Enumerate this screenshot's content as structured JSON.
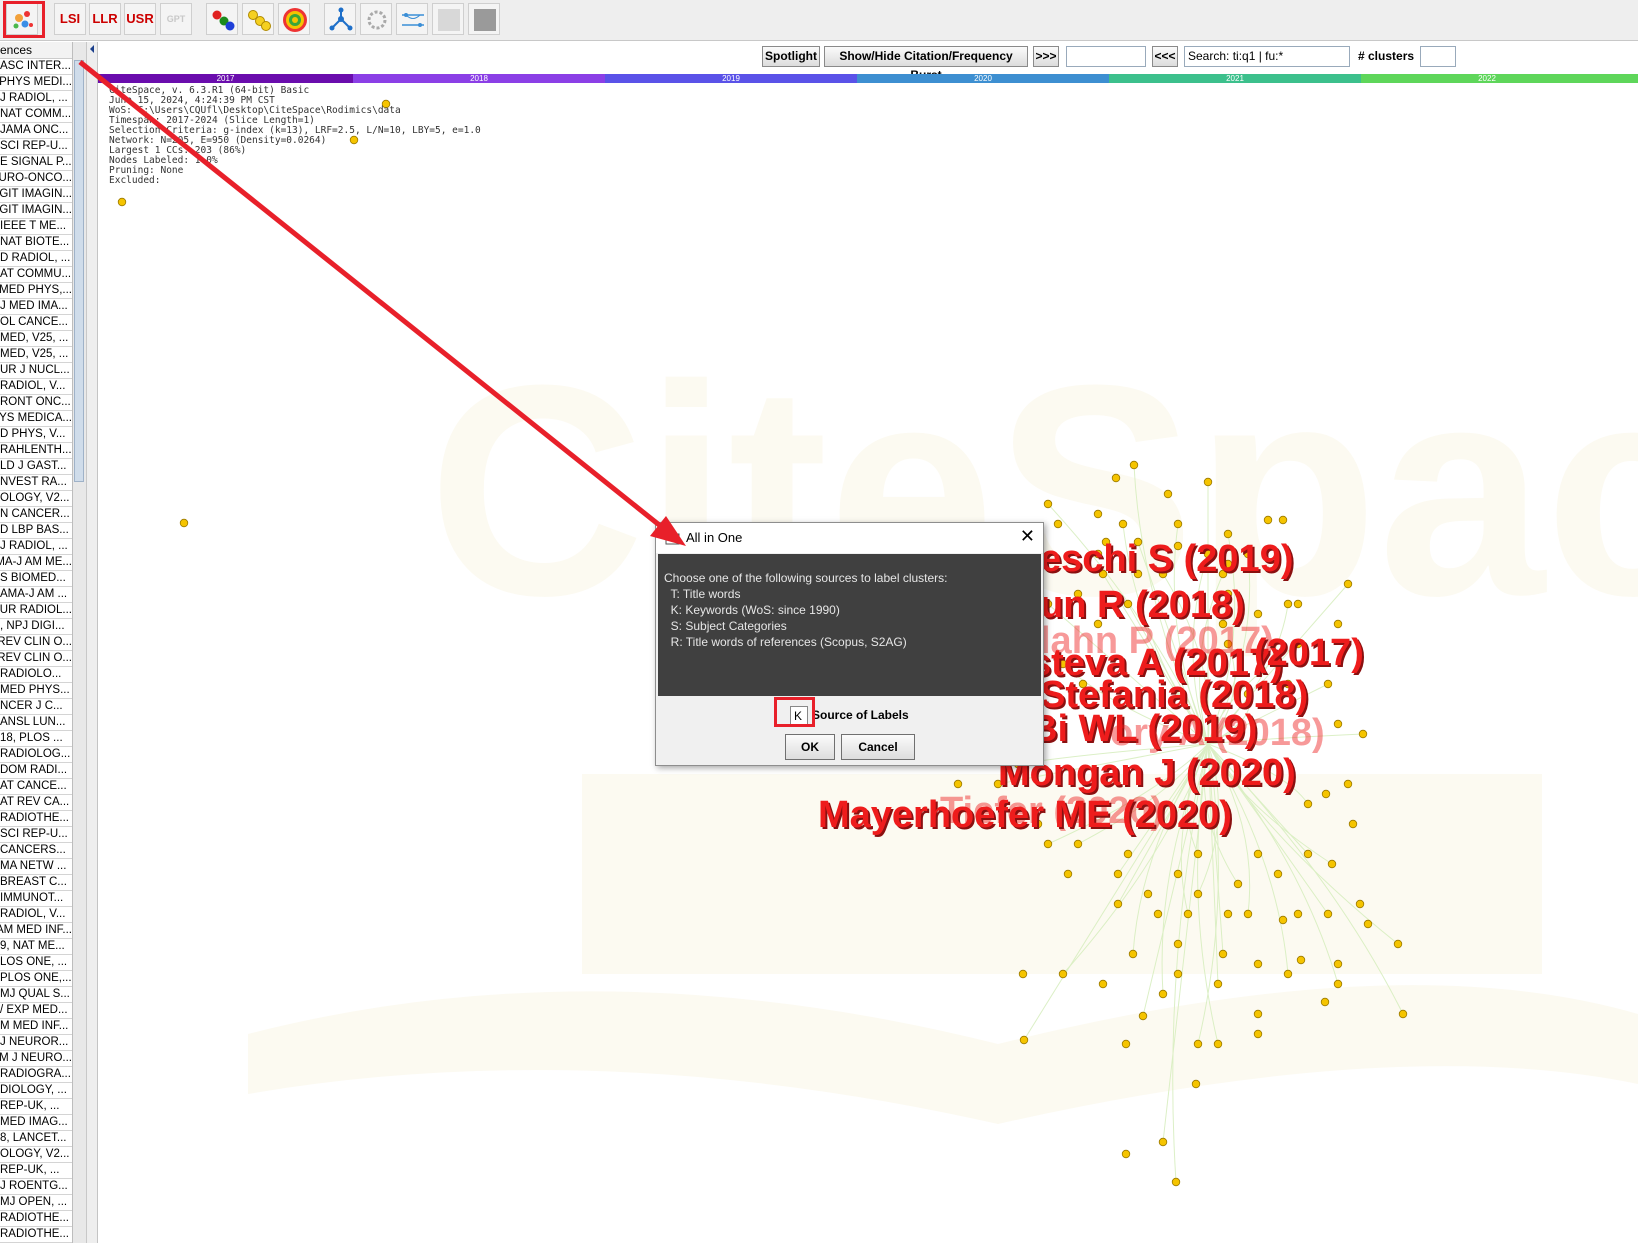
{
  "toolbar": {
    "buttons": [
      {
        "name": "cluster-explore-icon",
        "label": ""
      },
      {
        "name": "lsi-button",
        "label": "LSI"
      },
      {
        "name": "llr-button",
        "label": "LLR"
      },
      {
        "name": "usr-button",
        "label": "USR"
      },
      {
        "name": "gpt-button",
        "label": "GPT"
      },
      {
        "name": "nodes-color-icon",
        "label": ""
      },
      {
        "name": "nodes-yellow-icon",
        "label": ""
      },
      {
        "name": "target-icon",
        "label": ""
      },
      {
        "name": "network-icon",
        "label": ""
      },
      {
        "name": "circle-layout-icon",
        "label": ""
      },
      {
        "name": "timeline-icon",
        "label": ""
      },
      {
        "name": "image-icon",
        "label": ""
      },
      {
        "name": "photo-icon",
        "label": ""
      }
    ]
  },
  "left_list": {
    "header": "ences",
    "items": [
      "ASC INTER...",
      "PHYS MEDI...",
      "J RADIOL, ...",
      "NAT COMM...",
      "JAMA ONC...",
      "SCI REP-U...",
      "E SIGNAL P...",
      "URO-ONCO...",
      "GIT IMAGIN...",
      "GIT IMAGIN...",
      "IEEE T ME...",
      "NAT BIOTE...",
      "D RADIOL, ...",
      "AT COMMU...",
      "MED PHYS,...",
      "J MED IMA...",
      "OL CANCE...",
      "MED, V25, ...",
      "MED, V25, ...",
      "UR J NUCL...",
      "RADIOL, V...",
      "RONT ONC...",
      "YS MEDICA...",
      "D PHYS, V...",
      "RAHLENTH...",
      "LD J GAST...",
      "NVEST RA...",
      "OLOGY, V2...",
      "N CANCER...",
      "D LBP BAS...",
      "J RADIOL, ...",
      "MA-J AM ME...",
      "S BIOMED...",
      "AMA-J AM ...",
      "UR RADIOL...",
      ", NPJ DIGI...",
      "REV CLIN O...",
      "REV CLIN O...",
      "RADIOLO...",
      "MED PHYS...",
      "NCER J C...",
      "ANSL LUN...",
      "18, PLOS ...",
      "RADIOLOG...",
      "DOM RADI...",
      "AT CANCE...",
      "AT REV CA...",
      "RADIOTHE...",
      "SCI REP-U...",
      "CANCERS...",
      "MA NETW ...",
      "BREAST C...",
      "IMMUNOT...",
      "RADIOL, V...",
      "AM MED INF...",
      "9, NAT ME...",
      "LOS ONE, ...",
      "PLOS ONE,...",
      "MJ QUAL S...",
      "/ EXP MED...",
      "M MED INF...",
      "J NEUROR...",
      "M J NEURO...",
      "RADIOGRA...",
      "DIOLOGY, ...",
      "REP-UK, ...",
      "MED IMAG...",
      "8, LANCET...",
      "OLOGY, V2...",
      "REP-UK, ...",
      "J ROENTG...",
      "MJ OPEN, ...",
      "RADIOTHE...",
      "RADIOTHE..."
    ]
  },
  "controls": {
    "spotlight": "Spotlight",
    "burst": "Show/Hide Citation/Frequency Burst",
    "next": ">>>",
    "prev": "<<<",
    "search_value": "Search: ti:q1 | fu:*",
    "clusters_label": "# clusters",
    "blank_field": "",
    "clusters_value": ""
  },
  "timeline": {
    "years": [
      "2017",
      "2018",
      "2019",
      "2020",
      "2021",
      "2022"
    ],
    "colors": [
      "#6a0dad",
      "#8b3fe6",
      "#5a52e8",
      "#3d8fd1",
      "#3cc08c",
      "#5ed65a"
    ]
  },
  "info": {
    "lines": [
      "CiteSpace, v. 6.3.R1 (64-bit) Basic",
      "June 15, 2024, 4:24:39 PM CST",
      "WoS: C:\\Users\\CQUfl\\Desktop\\CiteSpace\\Rodimics\\data",
      "Timespan: 2017-2024 (Slice Length=1)",
      "Selection Criteria: g-index (k=13), LRF=2.5, L/N=10, LBY=5, e=1.0",
      "Network: N=205, E=950 (Density=0.0264)",
      "Largest 1 CCs: 203 (86%)",
      "Nodes Labeled: 1.0%",
      "Pruning: None",
      "Excluded:"
    ]
  },
  "node_labels": [
    {
      "text": "eschi S (2019)",
      "ghost": false
    },
    {
      "text": "un R (2018)",
      "ghost": false
    },
    {
      "text": "lahn P (2017)",
      "ghost": true
    },
    {
      "text": "steva A (2017)",
      "ghost": false
    },
    {
      "text": "(2017)",
      "ghost": false
    },
    {
      "text": "Stefania (2018)",
      "ghost": false
    },
    {
      "text": "Bi WL (2019)",
      "ghost": false
    },
    {
      "text": "ory A (2018)",
      "ghost": true
    },
    {
      "text": "Mongan J (2020)",
      "ghost": false
    },
    {
      "text": "Mayerhoefer ME (2020)",
      "ghost": false
    },
    {
      "text": "Tiefer (2020)",
      "ghost": true
    }
  ],
  "dialog": {
    "title": "All in One",
    "close": "✕",
    "prompt_lines": [
      "Choose one of the following sources to label clusters:",
      "  T: Title words",
      "  K: Keywords (WoS: since 1990)",
      "  S: Subject Categories",
      "  R: Title words of references (Scopus, S2AG)"
    ],
    "input_value": "K",
    "input_label": "Source of Labels",
    "ok": "OK",
    "cancel": "Cancel"
  },
  "colors": {
    "annotation": "#e8202a",
    "node": "#f5c400",
    "label": "#ee1c1c"
  }
}
